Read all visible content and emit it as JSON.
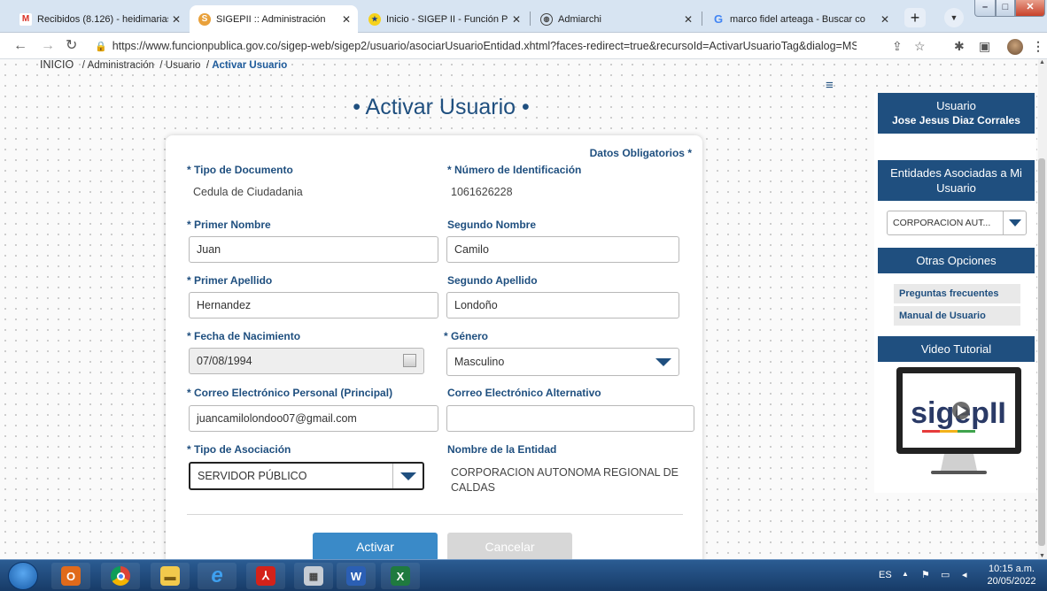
{
  "browser": {
    "tabs": [
      {
        "title": "Recibidos (8.126) - heidimarias",
        "icon": "gmail-icon",
        "active": false
      },
      {
        "title": "SIGEPII :: Administración",
        "icon": "sigep-icon",
        "active": true
      },
      {
        "title": "Inicio - SIGEP II - Función Públ",
        "icon": "colombia-icon",
        "active": false
      },
      {
        "title": "Admiarchi",
        "icon": "globe-icon",
        "active": false
      },
      {
        "title": "marco fidel arteaga - Buscar co",
        "icon": "google-icon",
        "active": false
      }
    ],
    "new_tab": "+",
    "url": "https://www.funcionpublica.gov.co/sigep-web/sigep2/usuario/asociarUsuarioEntidad.xhtml?faces-redirect=true&recursoId=ActivarUsuarioTag&dialog=MSG_USUA..."
  },
  "breadcrumb": {
    "home": "INICIO",
    "items": [
      "Administración",
      "Usuario"
    ],
    "current": "Activar Usuario",
    "sep": "/"
  },
  "page": {
    "title": "• Activar Usuario •"
  },
  "form": {
    "required_note": "Datos Obligatorios *",
    "tipo_documento": {
      "label": "* Tipo de Documento",
      "value": "Cedula de Ciudadania"
    },
    "numero_identificacion": {
      "label": "* Número de Identificación",
      "value": "1061626228"
    },
    "primer_nombre": {
      "label": "* Primer Nombre",
      "value": "Juan"
    },
    "segundo_nombre": {
      "label": "Segundo Nombre",
      "value": "Camilo"
    },
    "primer_apellido": {
      "label": "* Primer Apellido",
      "value": "Hernandez"
    },
    "segundo_apellido": {
      "label": "Segundo Apellido",
      "value": "Londoño"
    },
    "fecha_nacimiento": {
      "label": "* Fecha de Nacimiento",
      "value": "07/08/1994"
    },
    "genero": {
      "label": "* Género",
      "value": "Masculino"
    },
    "correo_principal": {
      "label": "* Correo Electrónico Personal (Principal)",
      "value": "juancamilolondoo07@gmail.com"
    },
    "correo_alternativo": {
      "label": "Correo Electrónico Alternativo",
      "value": ""
    },
    "tipo_asociacion": {
      "label": "* Tipo de Asociación",
      "value": "SERVIDOR PÚBLICO"
    },
    "nombre_entidad": {
      "label": "Nombre de la Entidad",
      "value": "CORPORACION AUTONOMA REGIONAL DE CALDAS"
    },
    "activar_label": "Activar",
    "cancelar_label": "Cancelar"
  },
  "sidebar": {
    "user_heading": "Usuario",
    "user_name": "Jose Jesus Diaz Corrales",
    "entidades_heading": "Entidades Asociadas a Mi Usuario",
    "entidad_selected": "CORPORACION AUT...",
    "otras_heading": "Otras Opciones",
    "links": [
      "Preguntas frecuentes",
      "Manual de Usuario"
    ],
    "video_heading": "Video Tutorial",
    "video_logo": "sigepII"
  },
  "taskbar": {
    "language": "ES",
    "time": "10:15 a.m.",
    "date": "20/05/2022"
  },
  "colors": {
    "primary": "#1f4f7f",
    "button": "#3a8ac8",
    "disabled_button": "#d7d7d7"
  }
}
